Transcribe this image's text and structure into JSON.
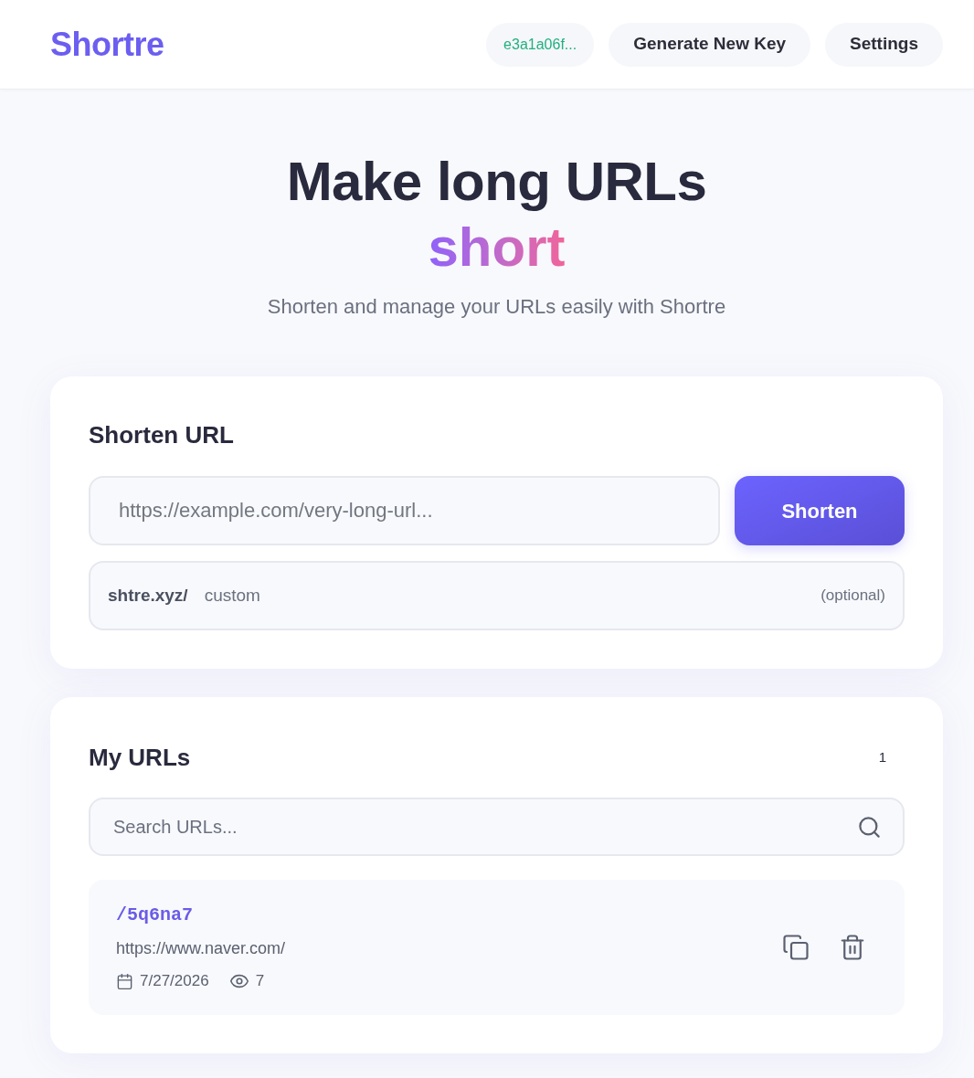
{
  "header": {
    "logo": "Shortre",
    "api_key": "e3a1a06f...",
    "generate_key_button": "Generate New Key",
    "settings_button": "Settings"
  },
  "hero": {
    "title": "Make long URLs",
    "highlight": "short",
    "subtitle": "Shorten and manage your URLs easily with Shortre"
  },
  "shorten_card": {
    "title": "Shorten URL",
    "url_field": {
      "placeholder": "https://example.com/very-long-url..."
    },
    "submit_button": "Shorten",
    "alias_field": {
      "prefix": "shtre.xyz/",
      "placeholder": "custom",
      "hint": "(optional)"
    }
  },
  "urls_card": {
    "title": "My URLs",
    "count": "1",
    "search": {
      "placeholder": "Search URLs..."
    },
    "items": [
      {
        "short_path": "/5q6na7",
        "original_url": "https://www.naver.com/",
        "date": "7/27/2026",
        "clicks": "7"
      }
    ]
  }
}
